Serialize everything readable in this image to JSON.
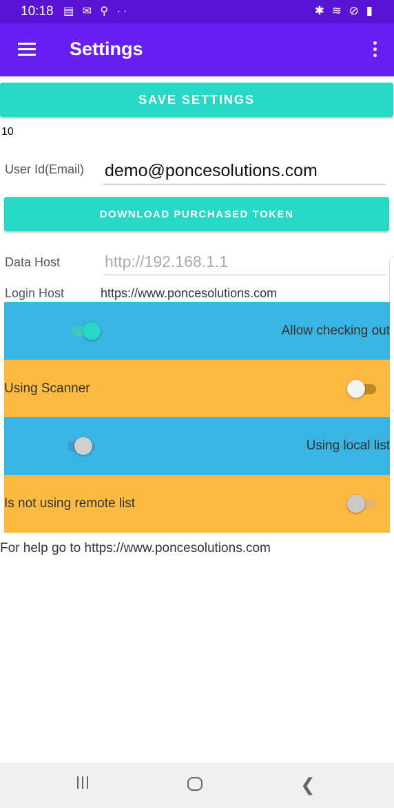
{
  "status_bar": {
    "time": "10:18",
    "notification_icons": "▤ ✉ ⚲ ··",
    "right_icons": "✱ ≋ ⊘ ▮"
  },
  "app_bar": {
    "title": "Settings",
    "menu_icon": "hamburger-menu-icon",
    "overflow_icon": "more-vertical-icon"
  },
  "actions": {
    "save_label": "SAVE SETTINGS",
    "download_label": "DOWNLOAD PURCHASED TOKEN"
  },
  "version_text": "10",
  "user": {
    "label": "User Id(Email)",
    "value": "demo@poncesolutions.com"
  },
  "data_host": {
    "label": "Data Host",
    "placeholder": "http://192.168.1.1"
  },
  "login_host": {
    "label": "Login Host",
    "value": "https://www.poncesolutions.com"
  },
  "toggles": [
    {
      "label": "Allow checking out",
      "state": true,
      "row_color": "#3ab4e2"
    },
    {
      "label": "Using Scanner",
      "state": false,
      "row_color": "#fcba40"
    },
    {
      "label": "Using local list",
      "state": false,
      "row_color": "#3ab4e2"
    },
    {
      "label": "Is not using remote list",
      "state": false,
      "row_color": "#fcba40"
    }
  ],
  "help_text": "For help go to https://www.poncesolutions.com",
  "colors": {
    "status_bar": "#5b14d6",
    "app_bar": "#6a1ff2",
    "accent": "#27d8c6",
    "blue_row": "#3ab4e2",
    "orange_row": "#fcba40"
  },
  "nav_bar": {
    "recents_icon": "recents-icon",
    "home_icon": "home-icon",
    "back_icon": "back-icon"
  }
}
